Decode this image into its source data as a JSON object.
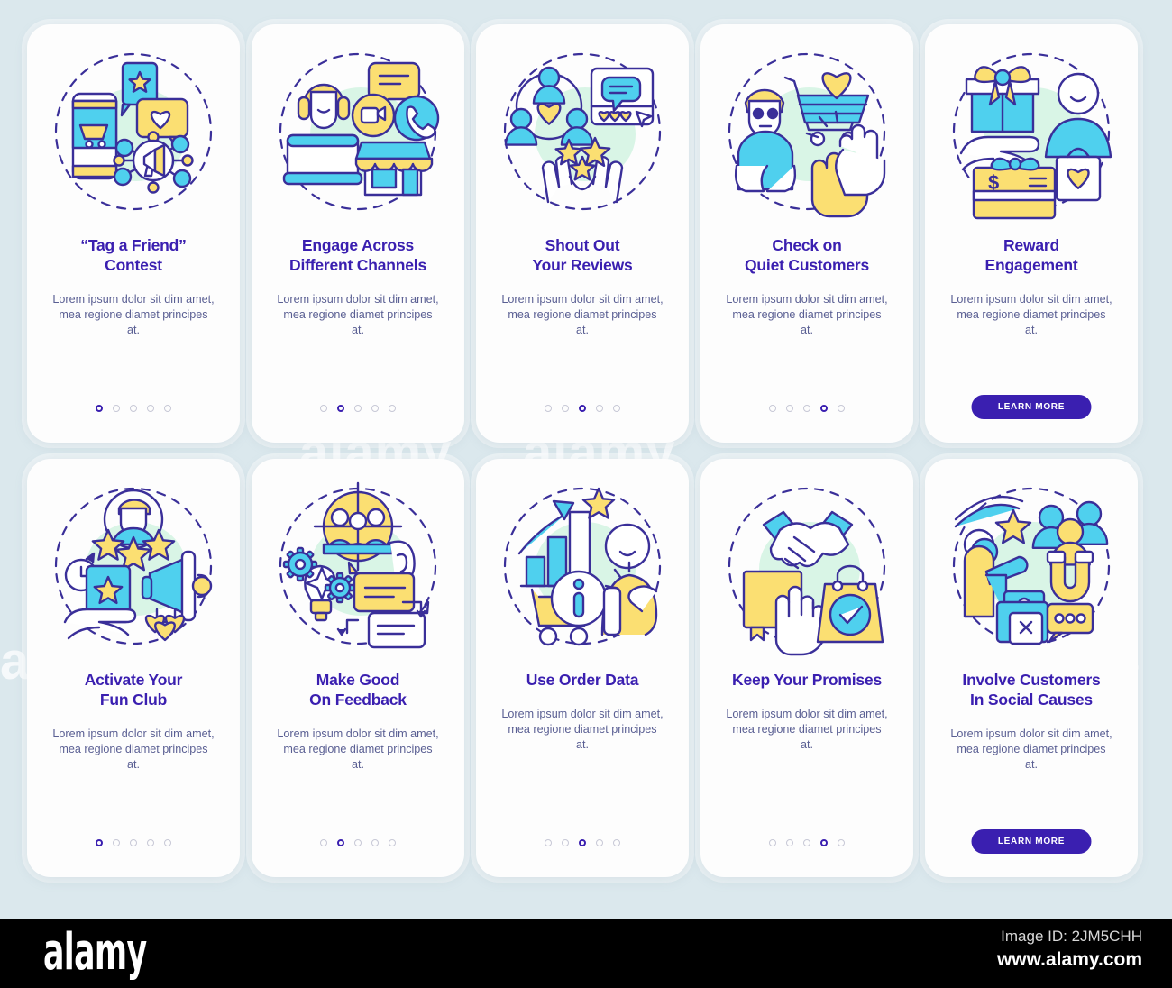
{
  "theme": {
    "background": "#dbe8ed",
    "card_background": "#fdfdfd",
    "title_color": "#3a1fb0",
    "body_color": "#5a5f93",
    "accent_purple": "#3a1fb0",
    "illustration_blue": "#4fd0ee",
    "illustration_yellow": "#fbdf72",
    "illustration_outline": "#3a2f99",
    "illustration_mint": "#c3f0d8",
    "dot_inactive": "#c7c8d6"
  },
  "body_text": "Lorem ipsum dolor sit dim amet, mea regione diamet principes at.",
  "learn_more_label": "LEARN MORE",
  "cards": [
    {
      "id": "tag-a-friend-contest",
      "title_lines": [
        "“Tag a Friend”",
        "Contest"
      ],
      "body": "Lorem ipsum dolor sit dim amet, mea regione diamet principes at.",
      "footer_type": "dots",
      "dots_total": 5,
      "dots_active_index": 0,
      "illustration": "phone-cart-star-heart-megaphone-network"
    },
    {
      "id": "engage-across-different-channels",
      "title_lines": [
        "Engage Across",
        "Different Channels"
      ],
      "body": "Lorem ipsum dolor sit dim amet, mea regione diamet principes at.",
      "footer_type": "dots",
      "dots_total": 5,
      "dots_active_index": 1,
      "illustration": "headset-agent-video-phone-chat-store"
    },
    {
      "id": "shout-out-your-reviews",
      "title_lines": [
        "Shout Out",
        "Your Reviews"
      ],
      "body": "Lorem ipsum dolor sit dim amet, mea regione diamet principes at.",
      "footer_type": "dots",
      "dots_total": 5,
      "dots_active_index": 2,
      "illustration": "people-heart-post-hands-stars"
    },
    {
      "id": "check-on-quiet-customers",
      "title_lines": [
        "Check on",
        "Quiet Customers"
      ],
      "body": "Lorem ipsum dolor sit dim amet, mea regione diamet principes at.",
      "footer_type": "dots",
      "dots_total": 5,
      "dots_active_index": 3,
      "illustration": "sad-person-cart-heart-high-five"
    },
    {
      "id": "reward-engagement",
      "title_lines": [
        "Reward",
        "Engagement"
      ],
      "body": "Lorem ipsum dolor sit dim amet, mea regione diamet principes at.",
      "footer_type": "button",
      "button_label": "LEARN MORE",
      "illustration": "gift-hand-giftcard-shopper-heartbag"
    },
    {
      "id": "activate-your-fun-club",
      "title_lines": [
        "Activate Your",
        "Fun Club"
      ],
      "body": "Lorem ipsum dolor sit dim amet, mea regione diamet principes at.",
      "footer_type": "dots",
      "dots_total": 5,
      "dots_active_index": 0,
      "illustration": "avatar-stars-clock-card-megaphone-hearts-hand"
    },
    {
      "id": "make-good-on-feedback",
      "title_lines": [
        "Make Good",
        "On Feedback"
      ],
      "body": "Lorem ipsum dolor sit dim amet, mea regione diamet principes at.",
      "footer_type": "dots",
      "dots_total": 5,
      "dots_active_index": 1,
      "illustration": "target-audience-ear-bulb-gears-chat-reply"
    },
    {
      "id": "use-order-data",
      "title_lines": [
        "Use Order Data"
      ],
      "body": "Lorem ipsum dolor sit dim amet, mea regione diamet principes at.",
      "footer_type": "dots",
      "dots_total": 5,
      "dots_active_index": 2,
      "illustration": "bar-chart-arrow-star-info-cart-person-tap"
    },
    {
      "id": "keep-your-promises",
      "title_lines": [
        "Keep Your Promises"
      ],
      "body": "Lorem ipsum dolor sit dim amet, mea regione diamet principes at.",
      "footer_type": "dots",
      "dots_total": 5,
      "dots_active_index": 3,
      "illustration": "handshake-oath-hand-bag-check"
    },
    {
      "id": "involve-customers-in-social-causes",
      "title_lines": [
        "Involve Customers",
        "In Social Causes"
      ],
      "body": "Lorem ipsum dolor sit dim amet, mea regione diamet principes at.",
      "footer_type": "button",
      "button_label": "LEARN MORE",
      "illustration": "speaker-star-people-magnet-profile-chat"
    }
  ],
  "watermarks": [
    "alamy",
    "alamy",
    "alamy",
    "a"
  ],
  "footer": {
    "logo": "alamy",
    "image_id": "Image ID: 2JM5CHH",
    "site": "www.alamy.com"
  }
}
